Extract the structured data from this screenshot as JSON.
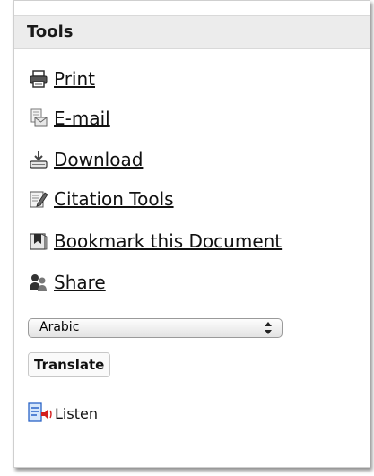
{
  "panel": {
    "title": "Tools"
  },
  "tools": [
    {
      "label": "Print",
      "icon": "printer-icon"
    },
    {
      "label": "E-mail",
      "icon": "email-icon"
    },
    {
      "label": "Download",
      "icon": "download-icon"
    },
    {
      "label": "Citation Tools",
      "icon": "citation-icon"
    },
    {
      "label": "Bookmark this Document",
      "icon": "bookmark-icon"
    },
    {
      "label": "Share",
      "icon": "share-icon"
    }
  ],
  "language_select": {
    "selected": "Arabic"
  },
  "translate_button": {
    "label": "Translate"
  },
  "listen": {
    "label": "Listen",
    "icon": "listen-icon"
  }
}
